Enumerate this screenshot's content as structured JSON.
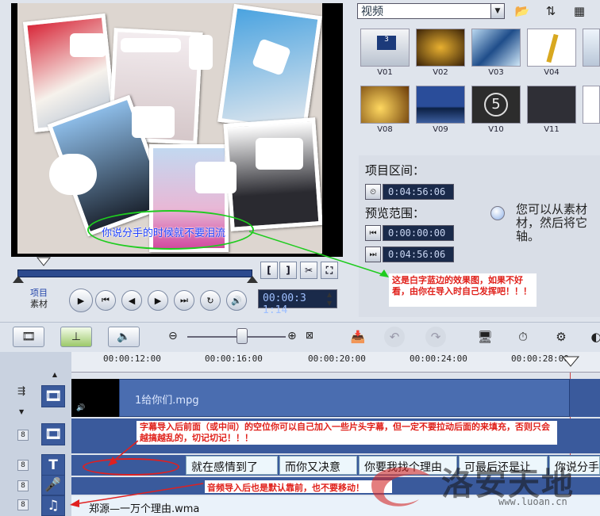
{
  "preview": {
    "subtitle": "你说分手的时候就不要泪流",
    "mode_labels": {
      "project": "项目",
      "clip": "素材"
    },
    "timecode": "00:00:3 1:14",
    "trim_buttons": [
      "[",
      "]"
    ]
  },
  "library": {
    "category": "视频",
    "thumbs": [
      {
        "label": "V01",
        "overlay": "3"
      },
      {
        "label": "V02",
        "overlay": ""
      },
      {
        "label": "V03",
        "overlay": ""
      },
      {
        "label": "V04",
        "overlay": ""
      },
      {
        "label": "V08",
        "overlay": ""
      },
      {
        "label": "V09",
        "overlay": ""
      },
      {
        "label": "V10",
        "overlay": "5"
      },
      {
        "label": "V11",
        "overlay": ""
      }
    ]
  },
  "options": {
    "project_range_label": "项目区间：",
    "project_duration": "0:04:56:06",
    "preview_range_label": "预览范围：",
    "preview_start": "0:00:00:00",
    "preview_end": "0:04:56:06",
    "hint": "您可以从素材材，然后将它轴。"
  },
  "annotations": {
    "note1": "这是白字蓝边的效果图，如果不好看，由你在导入时自己发挥吧！！！",
    "note2": "字幕导入后前面（或中间）的空位你可以自己加入一些片头字幕，但一定不要拉动后面的来填充，否则只会越搞越乱的，切记切记！！！",
    "note3": "音频导入后也是默认靠前，也不要移动！"
  },
  "timeline": {
    "ticks": [
      "00:00:12:00",
      "00:00:16:00",
      "00:00:20:00",
      "00:00:24:00",
      "00:00:28:00"
    ],
    "video_clip": "1给你们.mpg",
    "title_clips": [
      "就在感情到了",
      "而你又决意",
      "你要我找个理由",
      "可最后还是让",
      "你说分手"
    ],
    "audio_clip": "郑源—一万个理由.wma"
  },
  "watermark": {
    "text": "洛安天地",
    "url": "www.luoan.cn"
  },
  "colors": {
    "accent": "#3a5a9c",
    "annotation_red": "#e0201a",
    "highlight_green": "#1fcc1f"
  }
}
